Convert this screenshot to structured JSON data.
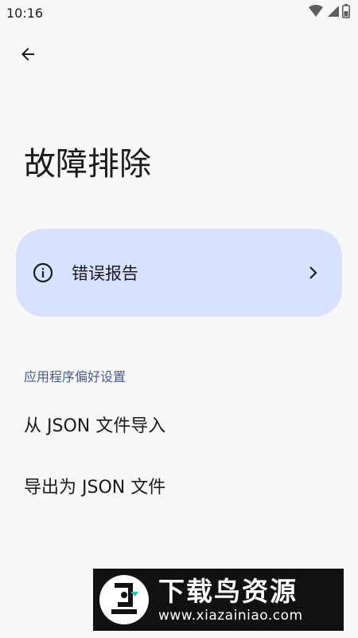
{
  "status_bar": {
    "time": "10:16"
  },
  "page": {
    "title": "故障排除"
  },
  "error_card": {
    "label": "错误报告"
  },
  "preferences": {
    "section_header": "应用程序偏好设置",
    "import_label": "从 JSON 文件导入",
    "export_label": "导出为 JSON 文件"
  },
  "watermark": {
    "title": "下载鸟资源",
    "url": "www.xiazainiao.com"
  },
  "icons": {
    "back": "arrow-back-icon",
    "info": "info-icon",
    "chevron": "chevron-right-icon",
    "wifi": "wifi-icon",
    "signal": "signal-icon",
    "battery": "battery-icon"
  },
  "colors": {
    "card_bg": "#d8e2ff",
    "section_header": "#4a5a92",
    "background": "#f8f8f8"
  }
}
